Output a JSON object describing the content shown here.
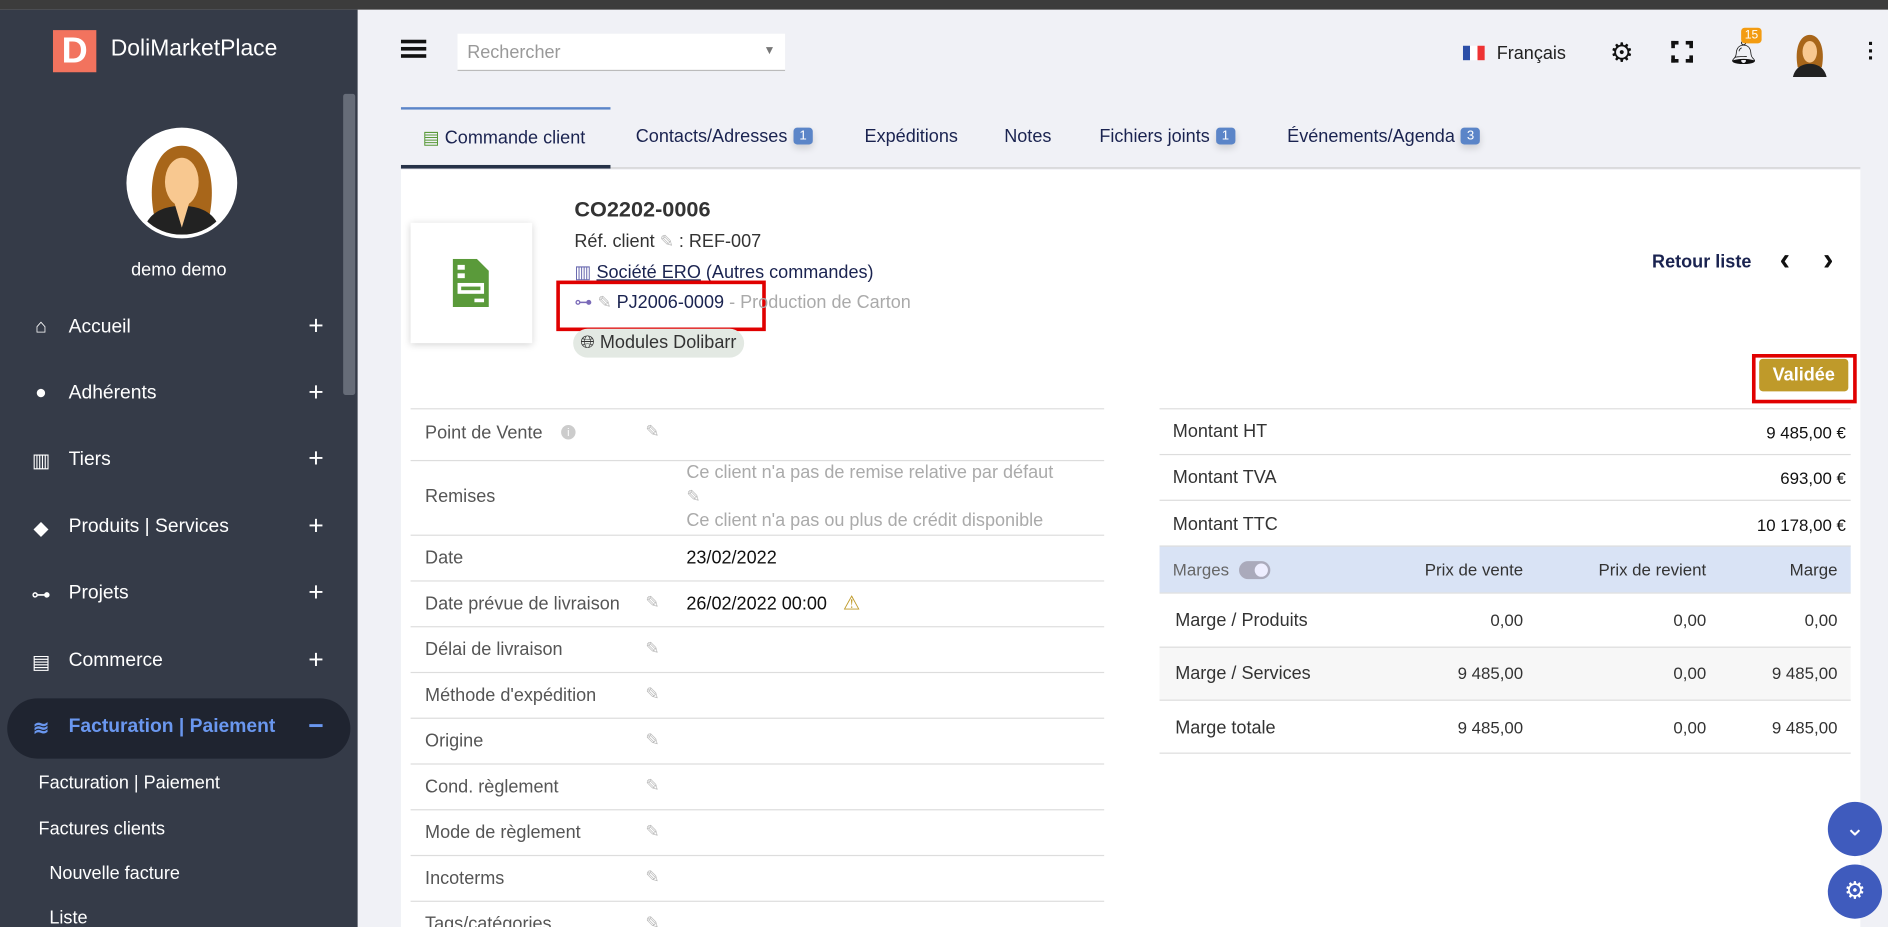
{
  "app": {
    "brand": "DoliMarketPlace",
    "logo_letter": "D",
    "user": "demo demo"
  },
  "sidebar": {
    "items": [
      {
        "label": "Accueil",
        "icon": "home-icon",
        "toggle": "+"
      },
      {
        "label": "Adhérents",
        "icon": "user-icon",
        "toggle": "+"
      },
      {
        "label": "Tiers",
        "icon": "building-icon",
        "toggle": "+"
      },
      {
        "label": "Produits | Services",
        "icon": "cube-icon",
        "toggle": "+"
      },
      {
        "label": "Projets",
        "icon": "sitemap-icon",
        "toggle": "+"
      },
      {
        "label": "Commerce",
        "icon": "briefcase-icon",
        "toggle": "+"
      },
      {
        "label": "Facturation | Paiement",
        "icon": "coins-icon",
        "toggle": "−"
      }
    ],
    "subitems": [
      "Facturation | Paiement",
      "Factures clients",
      "Nouvelle facture",
      "Liste"
    ]
  },
  "header": {
    "search_placeholder": "Rechercher",
    "language": "Français",
    "notifications": "15"
  },
  "tabs": [
    {
      "label": "Commande client"
    },
    {
      "label": "Contacts/Adresses",
      "badge": "1"
    },
    {
      "label": "Expéditions"
    },
    {
      "label": "Notes"
    },
    {
      "label": "Fichiers joints",
      "badge": "1"
    },
    {
      "label": "Événements/Agenda",
      "badge": "3"
    }
  ],
  "order": {
    "ref": "CO2202-0006",
    "ref_client_label": "Réf. client",
    "ref_client": ": REF-007",
    "company": "Société ERO",
    "company_extra": "(Autres commandes)",
    "project_ref": "PJ2006-0009",
    "project_name": "- Production de Carton",
    "tag": "Modules Dolibarr",
    "status": "Validée",
    "back": "Retour liste",
    "prev": "‹",
    "next": "›"
  },
  "fields": [
    {
      "label": "Point de Vente",
      "value": ""
    },
    {
      "label": "Remises",
      "value1": "Ce client n'a pas de remise relative par défaut",
      "value2": "Ce client n'a pas ou plus de crédit disponible"
    },
    {
      "label": "Date",
      "value": "23/02/2022"
    },
    {
      "label": "Date prévue de livraison",
      "value": "26/02/2022 00:00"
    },
    {
      "label": "Délai de livraison",
      "value": ""
    },
    {
      "label": "Méthode d'expédition",
      "value": ""
    },
    {
      "label": "Origine",
      "value": ""
    },
    {
      "label": "Cond. règlement",
      "value": ""
    },
    {
      "label": "Mode de règlement",
      "value": ""
    },
    {
      "label": "Incoterms",
      "value": ""
    },
    {
      "label": "Tags/catégories",
      "value": ""
    }
  ],
  "amounts": [
    {
      "label": "Montant HT",
      "value": "9 485,00 €"
    },
    {
      "label": "Montant TVA",
      "value": "693,00 €"
    },
    {
      "label": "Montant TTC",
      "value": "10 178,00 €"
    }
  ],
  "margins": {
    "headers": [
      "Marges",
      "Prix de vente",
      "Prix de revient",
      "Marge"
    ],
    "rows": [
      [
        "Marge / Produits",
        "0,00",
        "0,00",
        "0,00"
      ],
      [
        "Marge / Services",
        "9 485,00",
        "0,00",
        "9 485,00"
      ],
      [
        "Marge totale",
        "9 485,00",
        "0,00",
        "9 485,00"
      ]
    ]
  },
  "colors": {
    "sidebar": "#353b48",
    "accent": "#5b85c8",
    "status": "#bf9a2a",
    "highlight": "#e00000"
  }
}
